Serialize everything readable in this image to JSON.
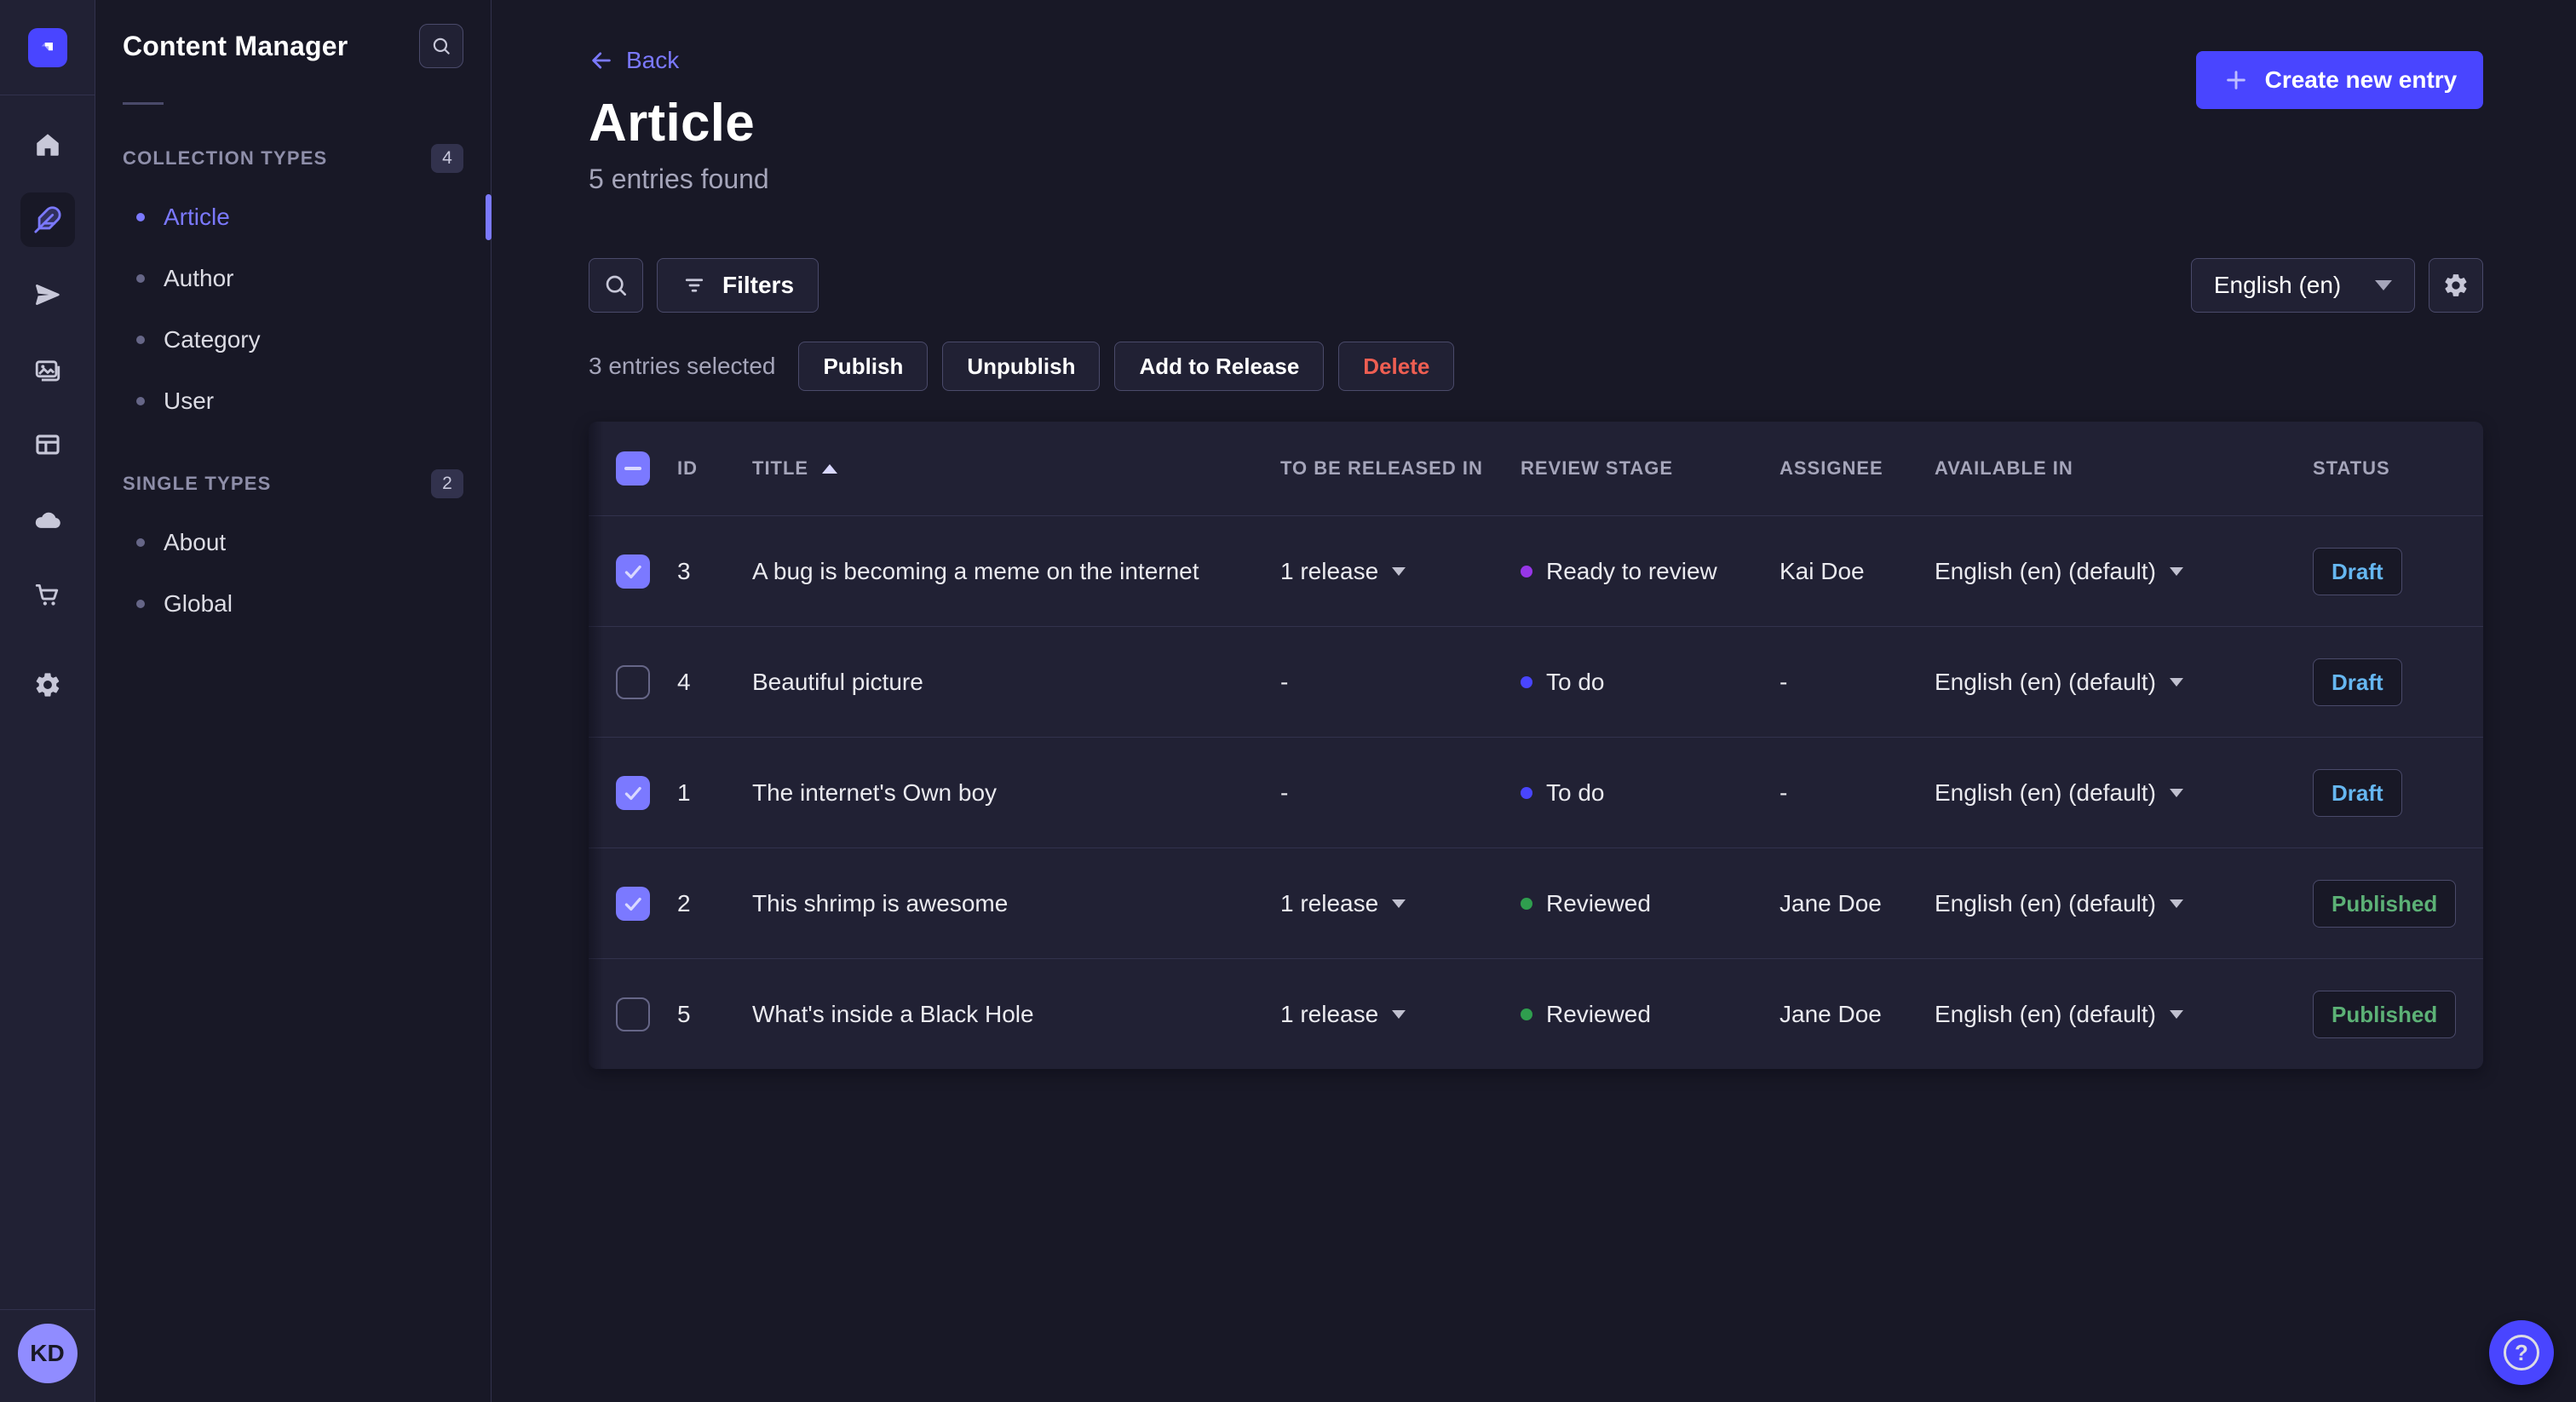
{
  "nav_rail": {
    "icons": [
      "home",
      "content-manager",
      "releases",
      "media-library",
      "content-type-builder",
      "cloud",
      "marketplace",
      "settings"
    ],
    "active_icon": "content-manager",
    "avatar_initials": "KD"
  },
  "sidebar": {
    "title": "Content Manager",
    "sections": [
      {
        "label": "COLLECTION TYPES",
        "badge": "4",
        "items": [
          {
            "label": "Article",
            "active": true
          },
          {
            "label": "Author",
            "active": false
          },
          {
            "label": "Category",
            "active": false
          },
          {
            "label": "User",
            "active": false
          }
        ]
      },
      {
        "label": "SINGLE TYPES",
        "badge": "2",
        "items": [
          {
            "label": "About",
            "active": false
          },
          {
            "label": "Global",
            "active": false
          }
        ]
      }
    ]
  },
  "header": {
    "back_label": "Back",
    "title": "Article",
    "subtitle": "5 entries found",
    "create_label": "Create new entry"
  },
  "toolbar": {
    "filters_label": "Filters",
    "locale_value": "English (en)"
  },
  "selection": {
    "text": "3 entries selected",
    "actions": [
      {
        "label": "Publish",
        "danger": false
      },
      {
        "label": "Unpublish",
        "danger": false
      },
      {
        "label": "Add to Release",
        "danger": false
      },
      {
        "label": "Delete",
        "danger": true
      }
    ]
  },
  "table": {
    "select_all_state": "indeterminate",
    "sorted_column": "TITLE",
    "sort_direction": "asc",
    "columns": {
      "id": "ID",
      "title": "TITLE",
      "released": "TO BE RELEASED IN",
      "stage": "REVIEW STAGE",
      "assignee": "ASSIGNEE",
      "available": "AVAILABLE IN",
      "status": "STATUS"
    },
    "rows": [
      {
        "id": "3",
        "checked": true,
        "title": "A bug is becoming a meme on the internet",
        "release": "1 release",
        "has_release_menu": true,
        "stage": "Ready to review",
        "stage_color": "#9736e8",
        "assignee": "Kai Doe",
        "locale": "English (en) (default)",
        "status": "Draft",
        "status_color": "#66b7f1"
      },
      {
        "id": "4",
        "checked": false,
        "title": "Beautiful picture",
        "release": "-",
        "has_release_menu": false,
        "stage": "To do",
        "stage_color": "#4945ff",
        "assignee": "-",
        "locale": "English (en) (default)",
        "status": "Draft",
        "status_color": "#66b7f1"
      },
      {
        "id": "1",
        "checked": true,
        "title": "The internet's Own boy",
        "release": "-",
        "has_release_menu": false,
        "stage": "To do",
        "stage_color": "#4945ff",
        "assignee": "-",
        "locale": "English (en) (default)",
        "status": "Draft",
        "status_color": "#66b7f1"
      },
      {
        "id": "2",
        "checked": true,
        "title": "This shrimp is awesome",
        "release": "1 release",
        "has_release_menu": true,
        "stage": "Reviewed",
        "stage_color": "#2f9e4e",
        "assignee": "Jane Doe",
        "locale": "English (en) (default)",
        "status": "Published",
        "status_color": "#5cb176"
      },
      {
        "id": "5",
        "checked": false,
        "title": "What's inside a Black Hole",
        "release": "1 release",
        "has_release_menu": true,
        "stage": "Reviewed",
        "stage_color": "#2f9e4e",
        "assignee": "Jane Doe",
        "locale": "English (en) (default)",
        "status": "Published",
        "status_color": "#5cb176"
      }
    ]
  },
  "help": {
    "icon": "?"
  },
  "colors": {
    "accent": "#4945ff",
    "link": "#7b79ff",
    "danger": "#ee5e52",
    "draft": "#66b7f1",
    "published": "#5cb176"
  }
}
